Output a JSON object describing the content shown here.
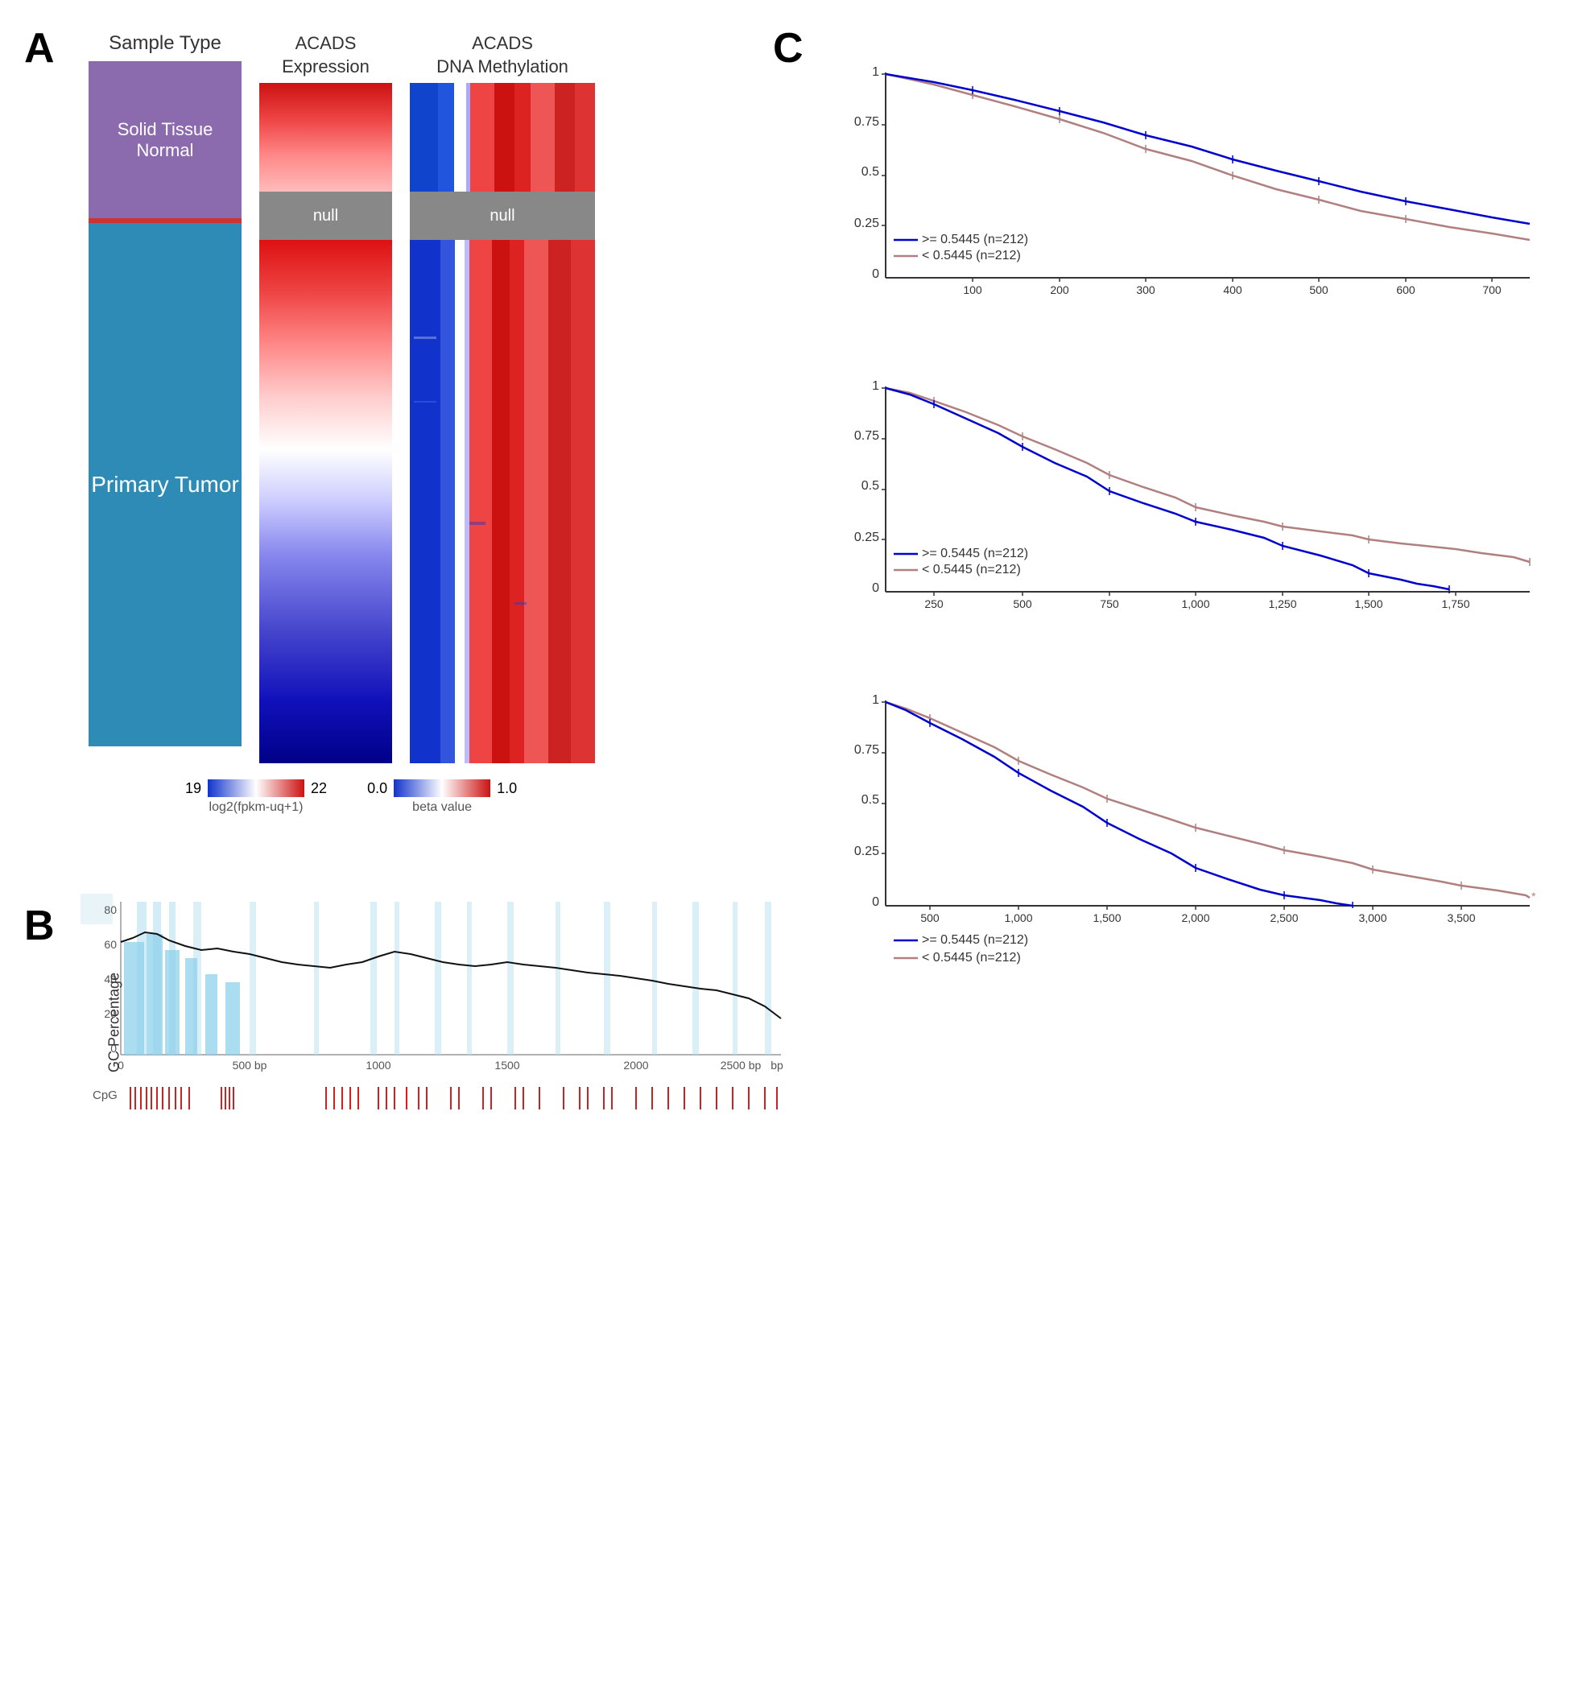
{
  "panel_a": {
    "label": "A",
    "sample_type_header": "Sample Type",
    "solid_tissue_normal": "Solid Tissue Normal",
    "primary_tumor": "Primary Tumor",
    "acads_expression_title": "ACADS\nExpression",
    "acads_methylation_title": "ACADS\nDNA Methylation",
    "null_label": "null",
    "legend_expr_min": "19",
    "legend_expr_max": "22",
    "legend_expr_sub": "log2(fpkm-uq+1)",
    "legend_meth_min": "0.0",
    "legend_meth_max": "1.0",
    "legend_meth_sub": "beta value"
  },
  "panel_b": {
    "label": "B",
    "y_label": "GC Percentage",
    "x_ticks": [
      "0",
      "500 bp",
      "1000",
      "1500",
      "2000",
      "2500 bp"
    ],
    "cpg_label": "CpG"
  },
  "panel_c": {
    "label": "C",
    "charts": [
      {
        "y_ticks": [
          "1",
          "0.75",
          "0.5",
          "0.25",
          "0"
        ],
        "x_ticks": [
          "100",
          "200",
          "300",
          "400",
          "500",
          "600",
          "700"
        ],
        "legend_blue": ">= 0.5445 (n=212)",
        "legend_gray": "< 0.5445 (n=212)"
      },
      {
        "y_ticks": [
          "1",
          "0.75",
          "0.5",
          "0.25",
          "0"
        ],
        "x_ticks": [
          "250",
          "500",
          "750",
          "1,000",
          "1,250",
          "1,500",
          "1,750"
        ],
        "legend_blue": ">= 0.5445 (n=212)",
        "legend_gray": "< 0.5445 (n=212)"
      },
      {
        "y_ticks": [
          "1",
          "0.75",
          "0.5",
          "0.25",
          "0"
        ],
        "x_ticks": [
          "500",
          "1,000",
          "1,500",
          "2,000",
          "2,500",
          "3,000",
          "3,500"
        ],
        "legend_blue": ">= 0.5445 (n=212)",
        "legend_gray": "< 0.5445 (n=212)"
      }
    ]
  }
}
